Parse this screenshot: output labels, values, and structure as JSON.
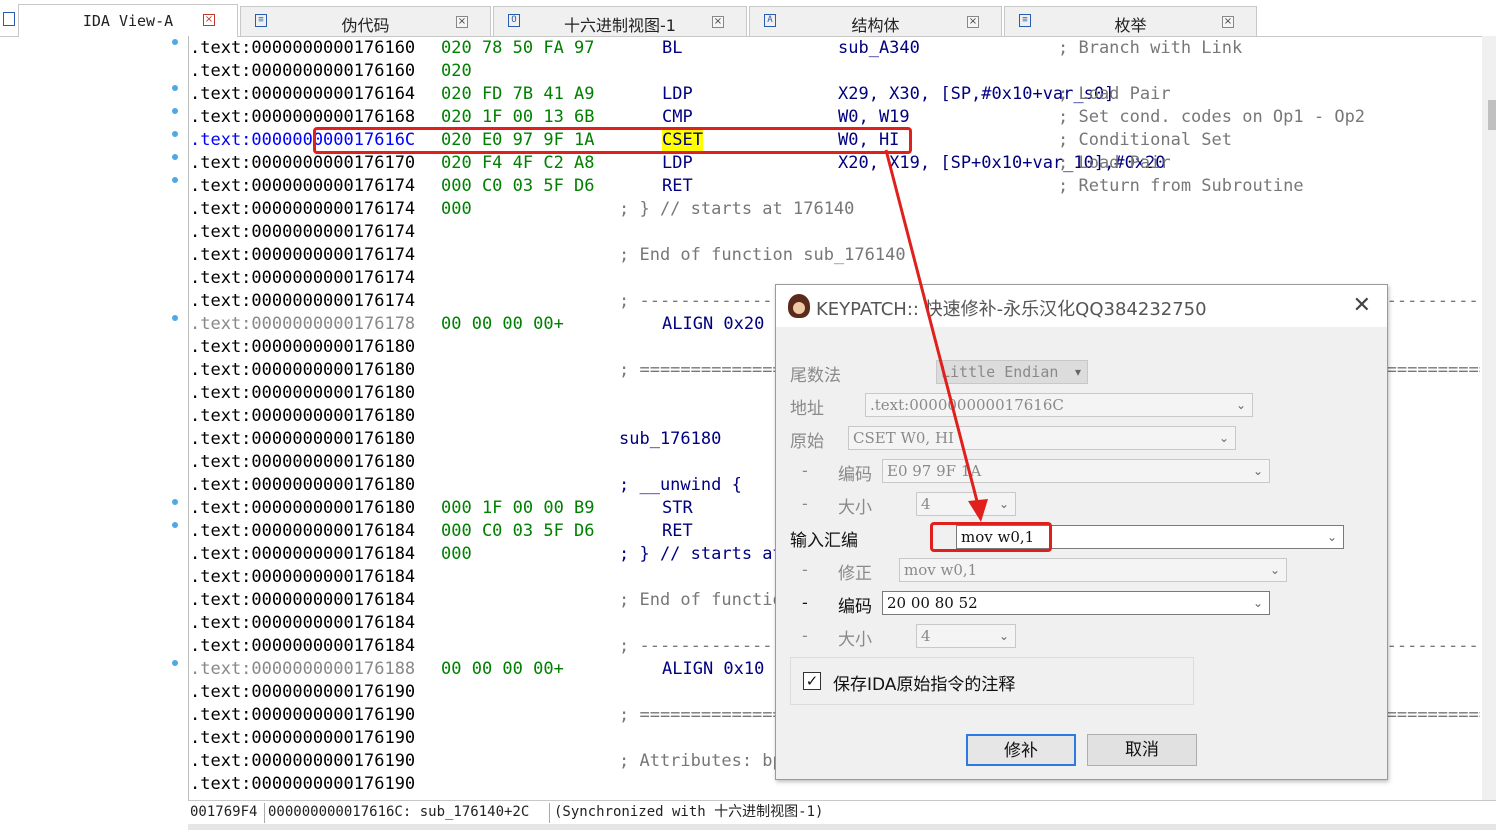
{
  "tabs": [
    {
      "label": "IDA View-A",
      "icon": "listing-icon",
      "active": true
    },
    {
      "label": "伪代码",
      "icon": "pseudocode-icon",
      "active": false
    },
    {
      "label": "十六进制视图-1",
      "icon": "hex-view-icon",
      "active": false
    },
    {
      "label": "结构体",
      "icon": "structures-icon",
      "active": false
    },
    {
      "label": "枚举",
      "icon": "enums-icon",
      "active": false
    }
  ],
  "listing": [
    {
      "addr": ".text:0000000000176160",
      "bytes": "020 78 50 FA 97",
      "mnem": "BL",
      "ops": "sub_A340",
      "cmt": "; Branch with Link",
      "bullet": true
    },
    {
      "addr": ".text:0000000000176160",
      "bytes": "020"
    },
    {
      "addr": ".text:0000000000176164",
      "bytes": "020 FD 7B 41 A9",
      "mnem": "LDP",
      "ops": "X29, X30, [SP,#0x10+var_s0]",
      "cmt": "; Load Pair",
      "bullet": true
    },
    {
      "addr": ".text:0000000000176168",
      "bytes": "020 1F 00 13 6B",
      "mnem": "CMP",
      "ops": "W0, W19",
      "cmt": "; Set cond. codes on Op1 - Op2",
      "bullet": true
    },
    {
      "addr": ".text:000000000017616C",
      "bytes": "020 E0 97 9F 1A",
      "mnem": "CSET",
      "ops": "W0, HI",
      "cmt": "; Conditional Set",
      "bullet": true,
      "highlight": true
    },
    {
      "addr": ".text:0000000000176170",
      "bytes": "020 F4 4F C2 A8",
      "mnem": "LDP",
      "ops": "X20, X19, [SP+0x10+var_10],#0x20",
      "cmt": "; Load Pair",
      "bullet": true
    },
    {
      "addr": ".text:0000000000176174",
      "bytes": "000 C0 03 5F D6",
      "mnem": "RET",
      "ops": "",
      "cmt": "; Return from Subroutine",
      "bullet": true
    },
    {
      "addr": ".text:0000000000176174",
      "bytes": "000",
      "blk": "; } // starts at 176140"
    },
    {
      "addr": ".text:0000000000176174"
    },
    {
      "addr": ".text:0000000000176174",
      "blk": "; End of function sub_176140"
    },
    {
      "addr": ".text:0000000000176174"
    },
    {
      "addr": ".text:0000000000176174",
      "blk": "; ---------------------------------------------------------------------------------------------------------"
    },
    {
      "addr": ".text:0000000000176178",
      "bytes": "00 00 00 00+",
      "mnem": "ALIGN 0x20",
      "bullet": true,
      "gray": true
    },
    {
      "addr": ".text:0000000000176180"
    },
    {
      "addr": ".text:0000000000176180",
      "blk": "; ========================================================================================================="
    },
    {
      "addr": ".text:0000000000176180"
    },
    {
      "addr": ".text:0000000000176180"
    },
    {
      "addr": ".text:0000000000176180",
      "sym": "sub_176180"
    },
    {
      "addr": ".text:0000000000176180"
    },
    {
      "addr": ".text:0000000000176180",
      "sym": "; __unwind {"
    },
    {
      "addr": ".text:0000000000176180",
      "bytes": "000 1F 00 00 B9",
      "mnem": "STR",
      "bullet": true
    },
    {
      "addr": ".text:0000000000176184",
      "bytes": "000 C0 03 5F D6",
      "mnem": "RET",
      "bullet": true
    },
    {
      "addr": ".text:0000000000176184",
      "bytes": "000",
      "sym": "; } // starts at 176180"
    },
    {
      "addr": ".text:0000000000176184"
    },
    {
      "addr": ".text:0000000000176184",
      "blk": "; End of function sub_176180"
    },
    {
      "addr": ".text:0000000000176184"
    },
    {
      "addr": ".text:0000000000176184",
      "blk": "; ---------------------------------------------------------------------------------------------------------"
    },
    {
      "addr": ".text:0000000000176188",
      "bytes": "00 00 00 00+",
      "mnem": "ALIGN 0x10",
      "bullet": true,
      "gray": true
    },
    {
      "addr": ".text:0000000000176190"
    },
    {
      "addr": ".text:0000000000176190",
      "blk": "; ========================================================================================================="
    },
    {
      "addr": ".text:0000000000176190"
    },
    {
      "addr": ".text:0000000000176190",
      "blk": "; Attributes: bp-based frame"
    },
    {
      "addr": ".text:0000000000176190"
    }
  ],
  "status": {
    "offset": "001769F4",
    "location": "000000000017616C: sub_176140+2C",
    "sync": "(Synchronized with 十六进制视图-1)"
  },
  "dialog": {
    "title": "KEYPATCH:: 快速修补-永乐汉化QQ384232750",
    "endian_label": "尾数法",
    "endian_value": "Little Endian",
    "address_label": "地址",
    "address_value": ".text:000000000017616C",
    "original_label": "原始",
    "original_value": "CSET W0, HI",
    "orig_encoding_label": "编码",
    "orig_encoding_value": "E0 97 9F 1A",
    "orig_size_label": "大小",
    "orig_size_value": "4",
    "input_label": "输入汇编",
    "input_value": "mov w0,1",
    "fixed_label": "修正",
    "fixed_value": "mov w0,1",
    "new_encoding_label": "编码",
    "new_encoding_value": "20 00 80 52",
    "new_size_label": "大小",
    "new_size_value": "4",
    "checkbox_label": "保存IDA原始指令的注释",
    "checkbox_checked": true,
    "patch_button": "修补",
    "cancel_button": "取消"
  },
  "colors": {
    "annotation_red": "#e0201c",
    "bytes_green": "#008000",
    "code_navy": "#000080",
    "comment_gray": "#777777",
    "highlight_yellow": "#ffff00"
  }
}
